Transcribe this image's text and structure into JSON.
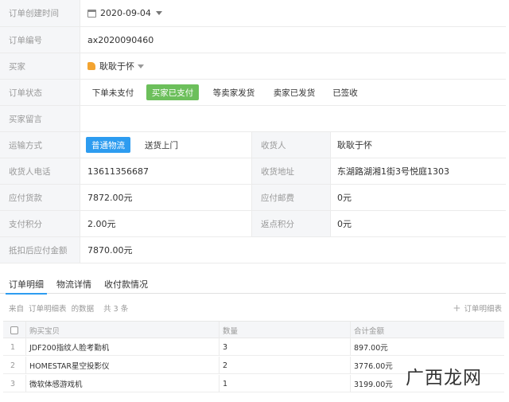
{
  "order": {
    "created_label": "订单创建时间",
    "created_value": "2020-09-04",
    "number_label": "订单编号",
    "number_value": "ax2020090460",
    "buyer_label": "买家",
    "buyer_value": "耿耿于怀",
    "status_label": "订单状态",
    "status_options": [
      "下单未支付",
      "买家已支付",
      "等卖家发货",
      "卖家已发货",
      "已签收"
    ],
    "status_selected": "买家已支付",
    "message_label": "买家留言",
    "message_value": "",
    "shipping_label": "运输方式",
    "shipping_options": [
      "普通物流",
      "送货上门"
    ],
    "shipping_selected": "普通物流",
    "receiver_label": "收货人",
    "receiver_value": "耿耿于怀",
    "phone_label": "收货人电话",
    "phone_value": "13611356687",
    "address_label": "收货地址",
    "address_value": "东湖路湖湘1街3号悦庭1303",
    "goods_label": "应付货款",
    "goods_value": "7872.00元",
    "postage_label": "应付邮费",
    "postage_value": "0元",
    "points_label": "支付积分",
    "points_value": "2.00元",
    "rebate_label": "返点积分",
    "rebate_value": "0元",
    "final_label": "抵扣后应付金额",
    "final_value": "7870.00元"
  },
  "tabs": [
    "订单明细",
    "物流详情",
    "收付款情况"
  ],
  "active_tab": "订单明细",
  "detail": {
    "source_prefix": "来自",
    "source_name": "订单明细表",
    "source_suffix": "的数据",
    "count_text": "共 3 条",
    "add_label": "订单明细表"
  },
  "table": {
    "headers": [
      "购买宝贝",
      "数量",
      "合计金额"
    ],
    "rows": [
      {
        "index": "1",
        "item": "JDF200指纹人脸考勤机",
        "qty": "3",
        "total": "897.00元"
      },
      {
        "index": "2",
        "item": "HOMESTAR星空投影仪",
        "qty": "2",
        "total": "3776.00元"
      },
      {
        "index": "3",
        "item": "微软体感游戏机",
        "qty": "1",
        "total": "3199.00元"
      }
    ]
  },
  "watermark": "广西龙网",
  "colors": {
    "status_active": "#6cbf5b",
    "shipping_active": "#2d9cf0",
    "tab_underline": "#2d9cf0"
  }
}
